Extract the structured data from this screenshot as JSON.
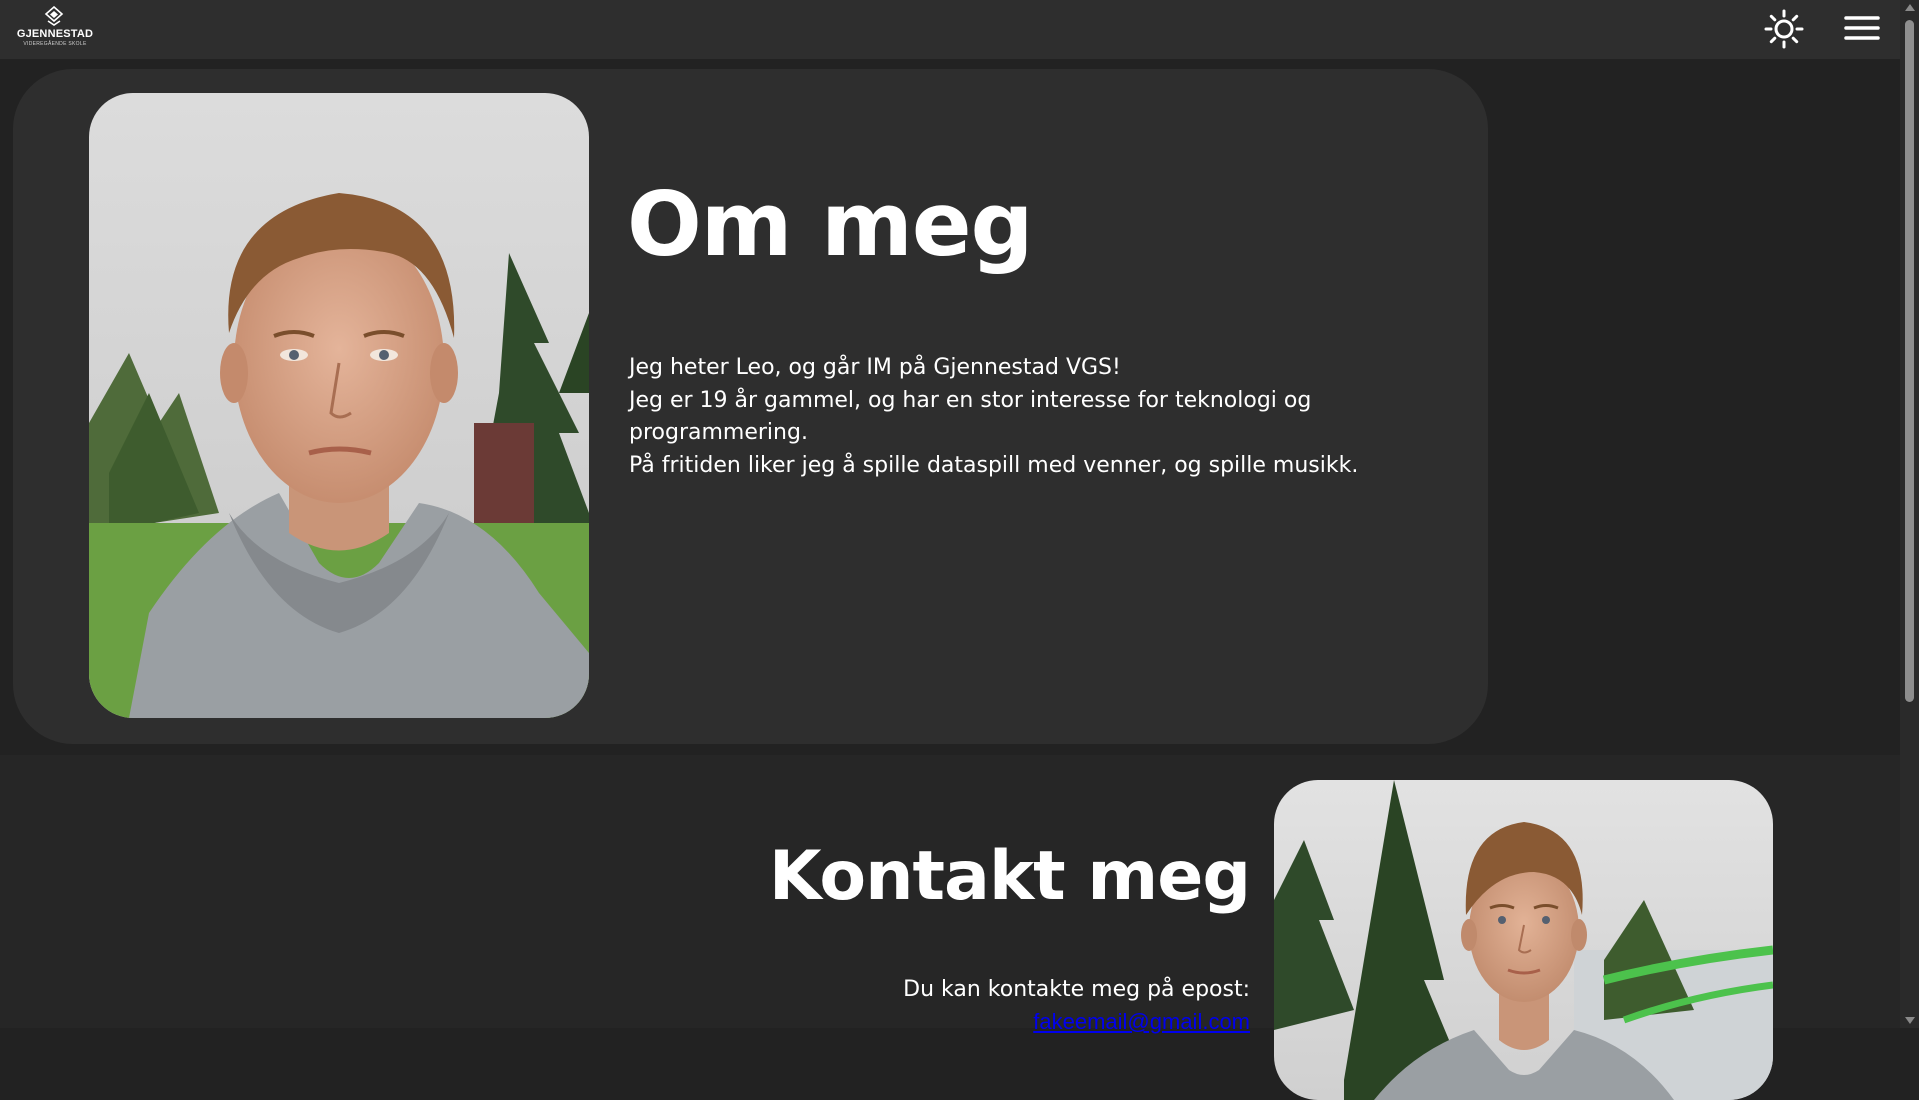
{
  "header": {
    "logo_text": "GJENNESTAD",
    "logo_subtext": "VIDEREGÅENDE SKOLE"
  },
  "about": {
    "title": "Om meg",
    "paragraphs": [
      "Jeg heter Leo, og går IM på Gjennestad VGS!",
      "Jeg er 19 år gammel, og har en stor interesse for teknologi og programmering.",
      "På fritiden liker jeg å spille dataspill med venner, og spille musikk."
    ]
  },
  "contact": {
    "title": "Kontakt meg",
    "intro": "Du kan kontakte meg på epost:",
    "email": "fakeemail@gmail.com"
  },
  "colors": {
    "page_background": "#222222",
    "header_background": "#2e2e2e",
    "card_background": "#2e2e2e",
    "text": "#ffffff",
    "link": "#0000ee"
  },
  "icons": {
    "theme_toggle": "sun-icon",
    "menu": "hamburger-menu-icon",
    "logo": "gjennestad-logo-mark"
  }
}
